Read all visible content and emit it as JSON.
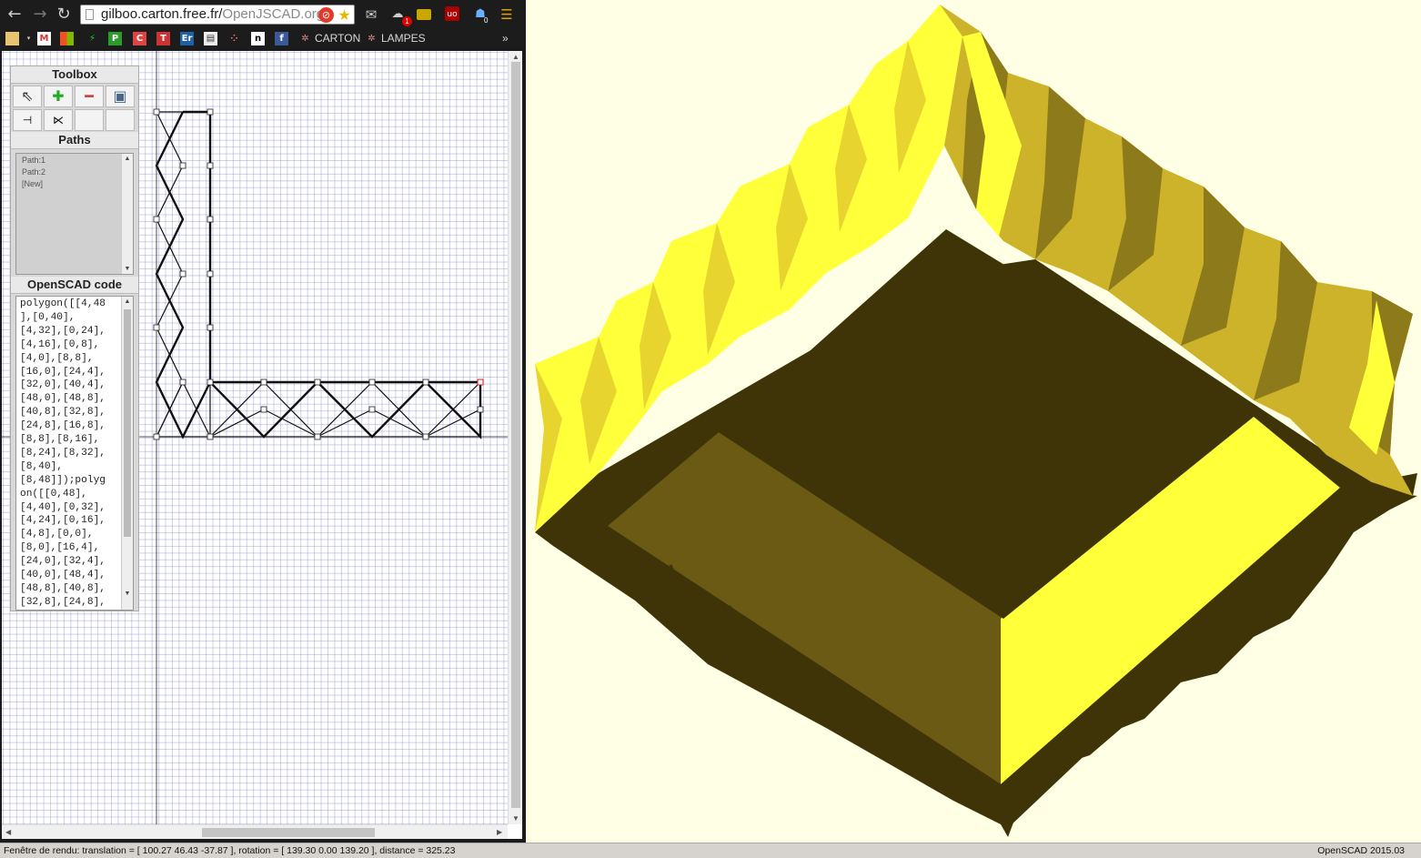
{
  "browser": {
    "url_host": "gilboo.carton.free.fr/",
    "url_path": "OpenJSCAD.org",
    "extension_badge": "1",
    "ext_counter": "0",
    "bookmarks": [
      {
        "label": "CARTON"
      },
      {
        "label": "LAMPES"
      }
    ],
    "overflow": "»"
  },
  "toolbox": {
    "title": "Toolbox",
    "paths_title": "Paths",
    "paths": [
      "Path:1",
      "Path:2",
      "[New]"
    ],
    "code_title": "OpenSCAD code",
    "code_lines": [
      "polygon([[4,48",
      "],[0,40],",
      "[4,32],[0,24],",
      "[4,16],[0,8],",
      "[4,0],[8,8],",
      "[16,0],[24,4],",
      "[32,0],[40,4],",
      "[48,0],[48,8],",
      "[40,8],[32,8],",
      "[24,8],[16,8],",
      "[8,8],[8,16],",
      "[8,24],[8,32],",
      "[8,40],",
      "[8,48]]);polyg",
      "on([[0,48],",
      "[4,40],[0,32],",
      "[4,24],[0,16],",
      "[4,8],[0,0],",
      "[8,0],[16,4],",
      "[24,0],[32,4],",
      "[40,0],[48,4],",
      "[48,8],[40,8],",
      "[32,8],[24,8],"
    ]
  },
  "status": {
    "left": "Fenêtre de rendu: translation = [ 100.27 46.43 -37.87 ], rotation = [ 139.30 0.00 139.20 ], distance = 325.23",
    "right": "OpenSCAD 2015.03"
  },
  "colors": {
    "model_bright": "#ffff3a",
    "model_mid": "#e8d42e",
    "model_dark": "#6b5a14",
    "model_darkest": "#3e3408",
    "view_bg": "#ffffe5"
  }
}
